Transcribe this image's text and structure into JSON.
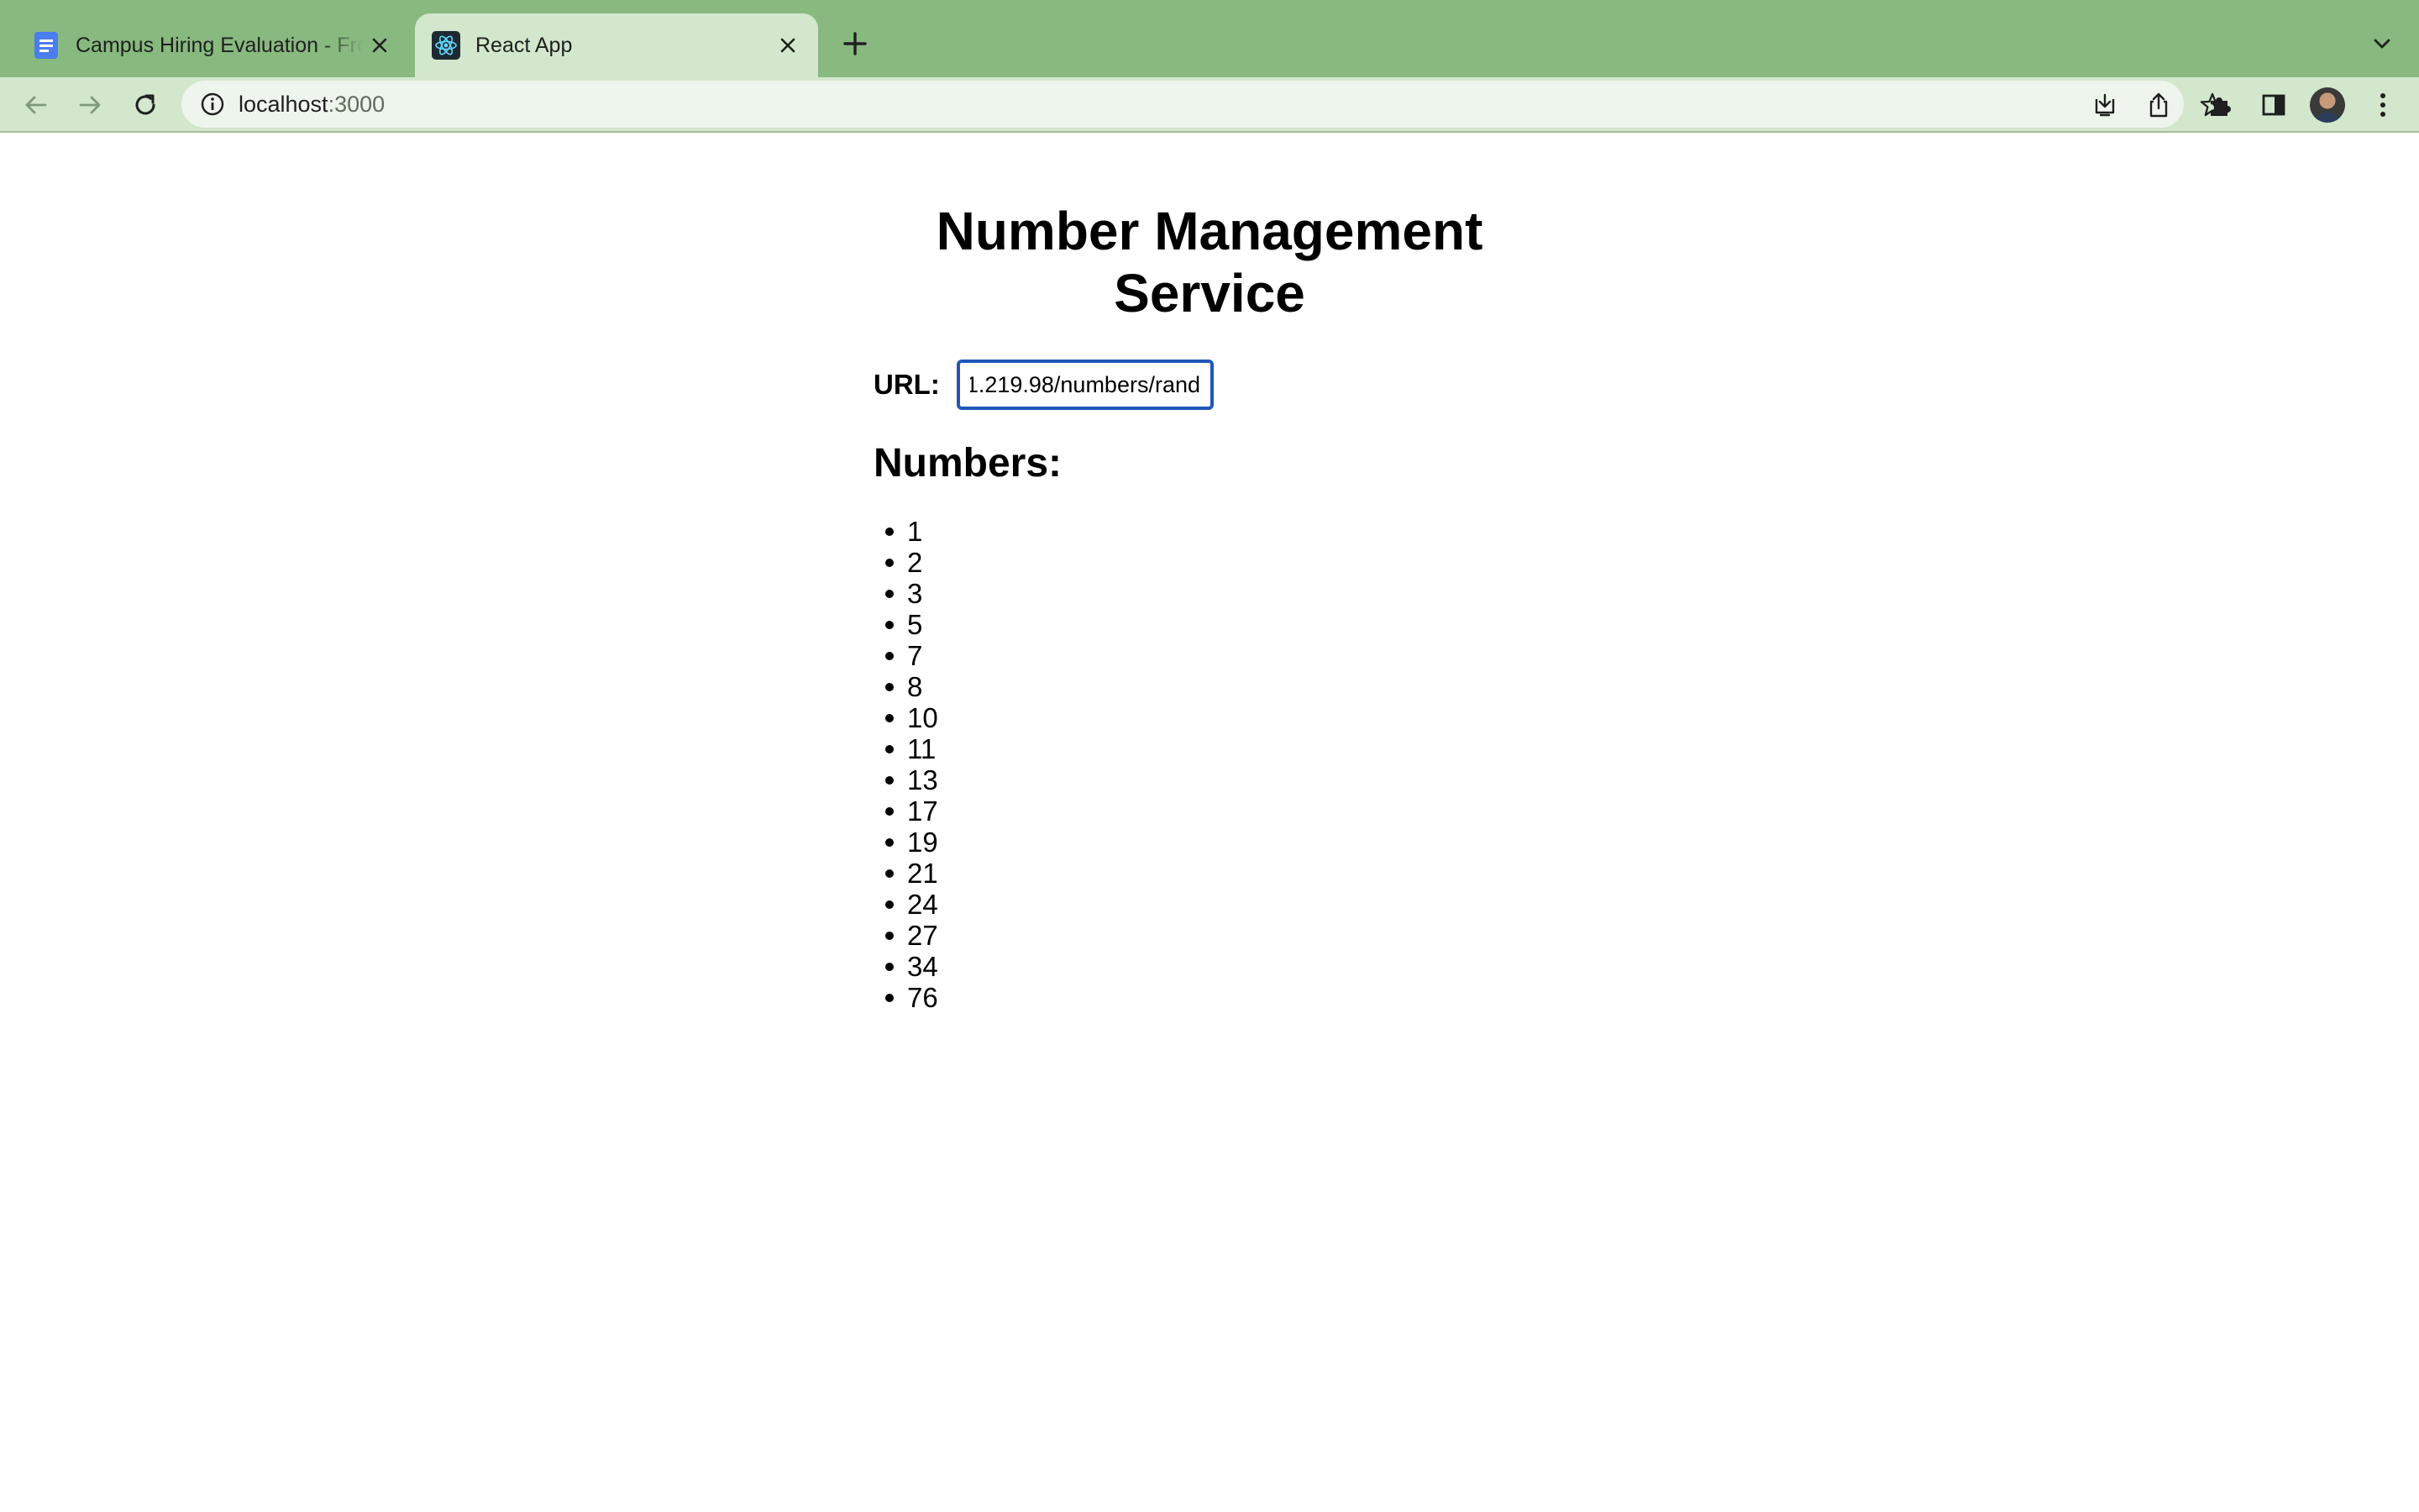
{
  "browser": {
    "tabs": [
      {
        "title": "Campus Hiring Evaluation - Frontend",
        "favicon": "docs-icon",
        "active": false
      },
      {
        "title": "React App",
        "favicon": "react-icon",
        "active": true
      }
    ],
    "address": {
      "host": "localhost",
      "port": ":3000"
    },
    "colors": {
      "tabstrip": "#88b97f",
      "toolbar": "#d2e7cc",
      "omnibox": "#eef5ec"
    }
  },
  "app": {
    "title_line1": "Number Management",
    "title_line2": "Service",
    "url_label": "URL:",
    "url_value": "1.219.98/numbers/rand",
    "numbers_heading": "Numbers:",
    "numbers": [
      "1",
      "2",
      "3",
      "5",
      "7",
      "8",
      "10",
      "11",
      "13",
      "17",
      "19",
      "21",
      "24",
      "27",
      "34",
      "76"
    ]
  }
}
